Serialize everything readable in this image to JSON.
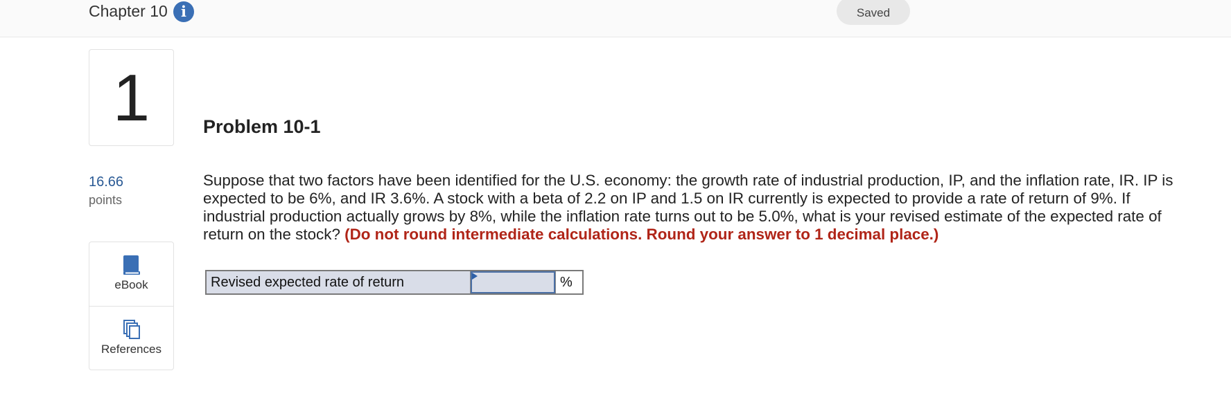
{
  "header": {
    "chapter_title": "Chapter 10",
    "info_icon": "info-icon",
    "status": "Saved"
  },
  "question": {
    "number": "1",
    "points_value": "16.66",
    "points_label": "points",
    "title": "Problem 10-1",
    "body": "Suppose that two factors have been identified for the U.S. economy: the growth rate of industrial production, IP, and the inflation rate, IR. IP is expected to be 6%, and IR 3.6%. A stock with a beta of 2.2 on IP and 1.5 on IR currently is expected to provide a rate of return of 9%. If industrial production actually grows by 8%, while the inflation rate turns out to be 5.0%, what is your revised estimate of the expected rate of return on the stock?",
    "instruction": "(Do not round intermediate calculations. Round your answer to 1 decimal place.)"
  },
  "resources": {
    "items": [
      {
        "label": "eBook",
        "icon": "book-icon"
      },
      {
        "label": "References",
        "icon": "copy-icon"
      }
    ]
  },
  "answer": {
    "label": "Revised expected rate of return",
    "value": "",
    "unit": "%"
  },
  "colors": {
    "accent_blue": "#3a6fb5",
    "instruction_red": "#b02518",
    "answer_row_bg": "#d9dde8"
  }
}
